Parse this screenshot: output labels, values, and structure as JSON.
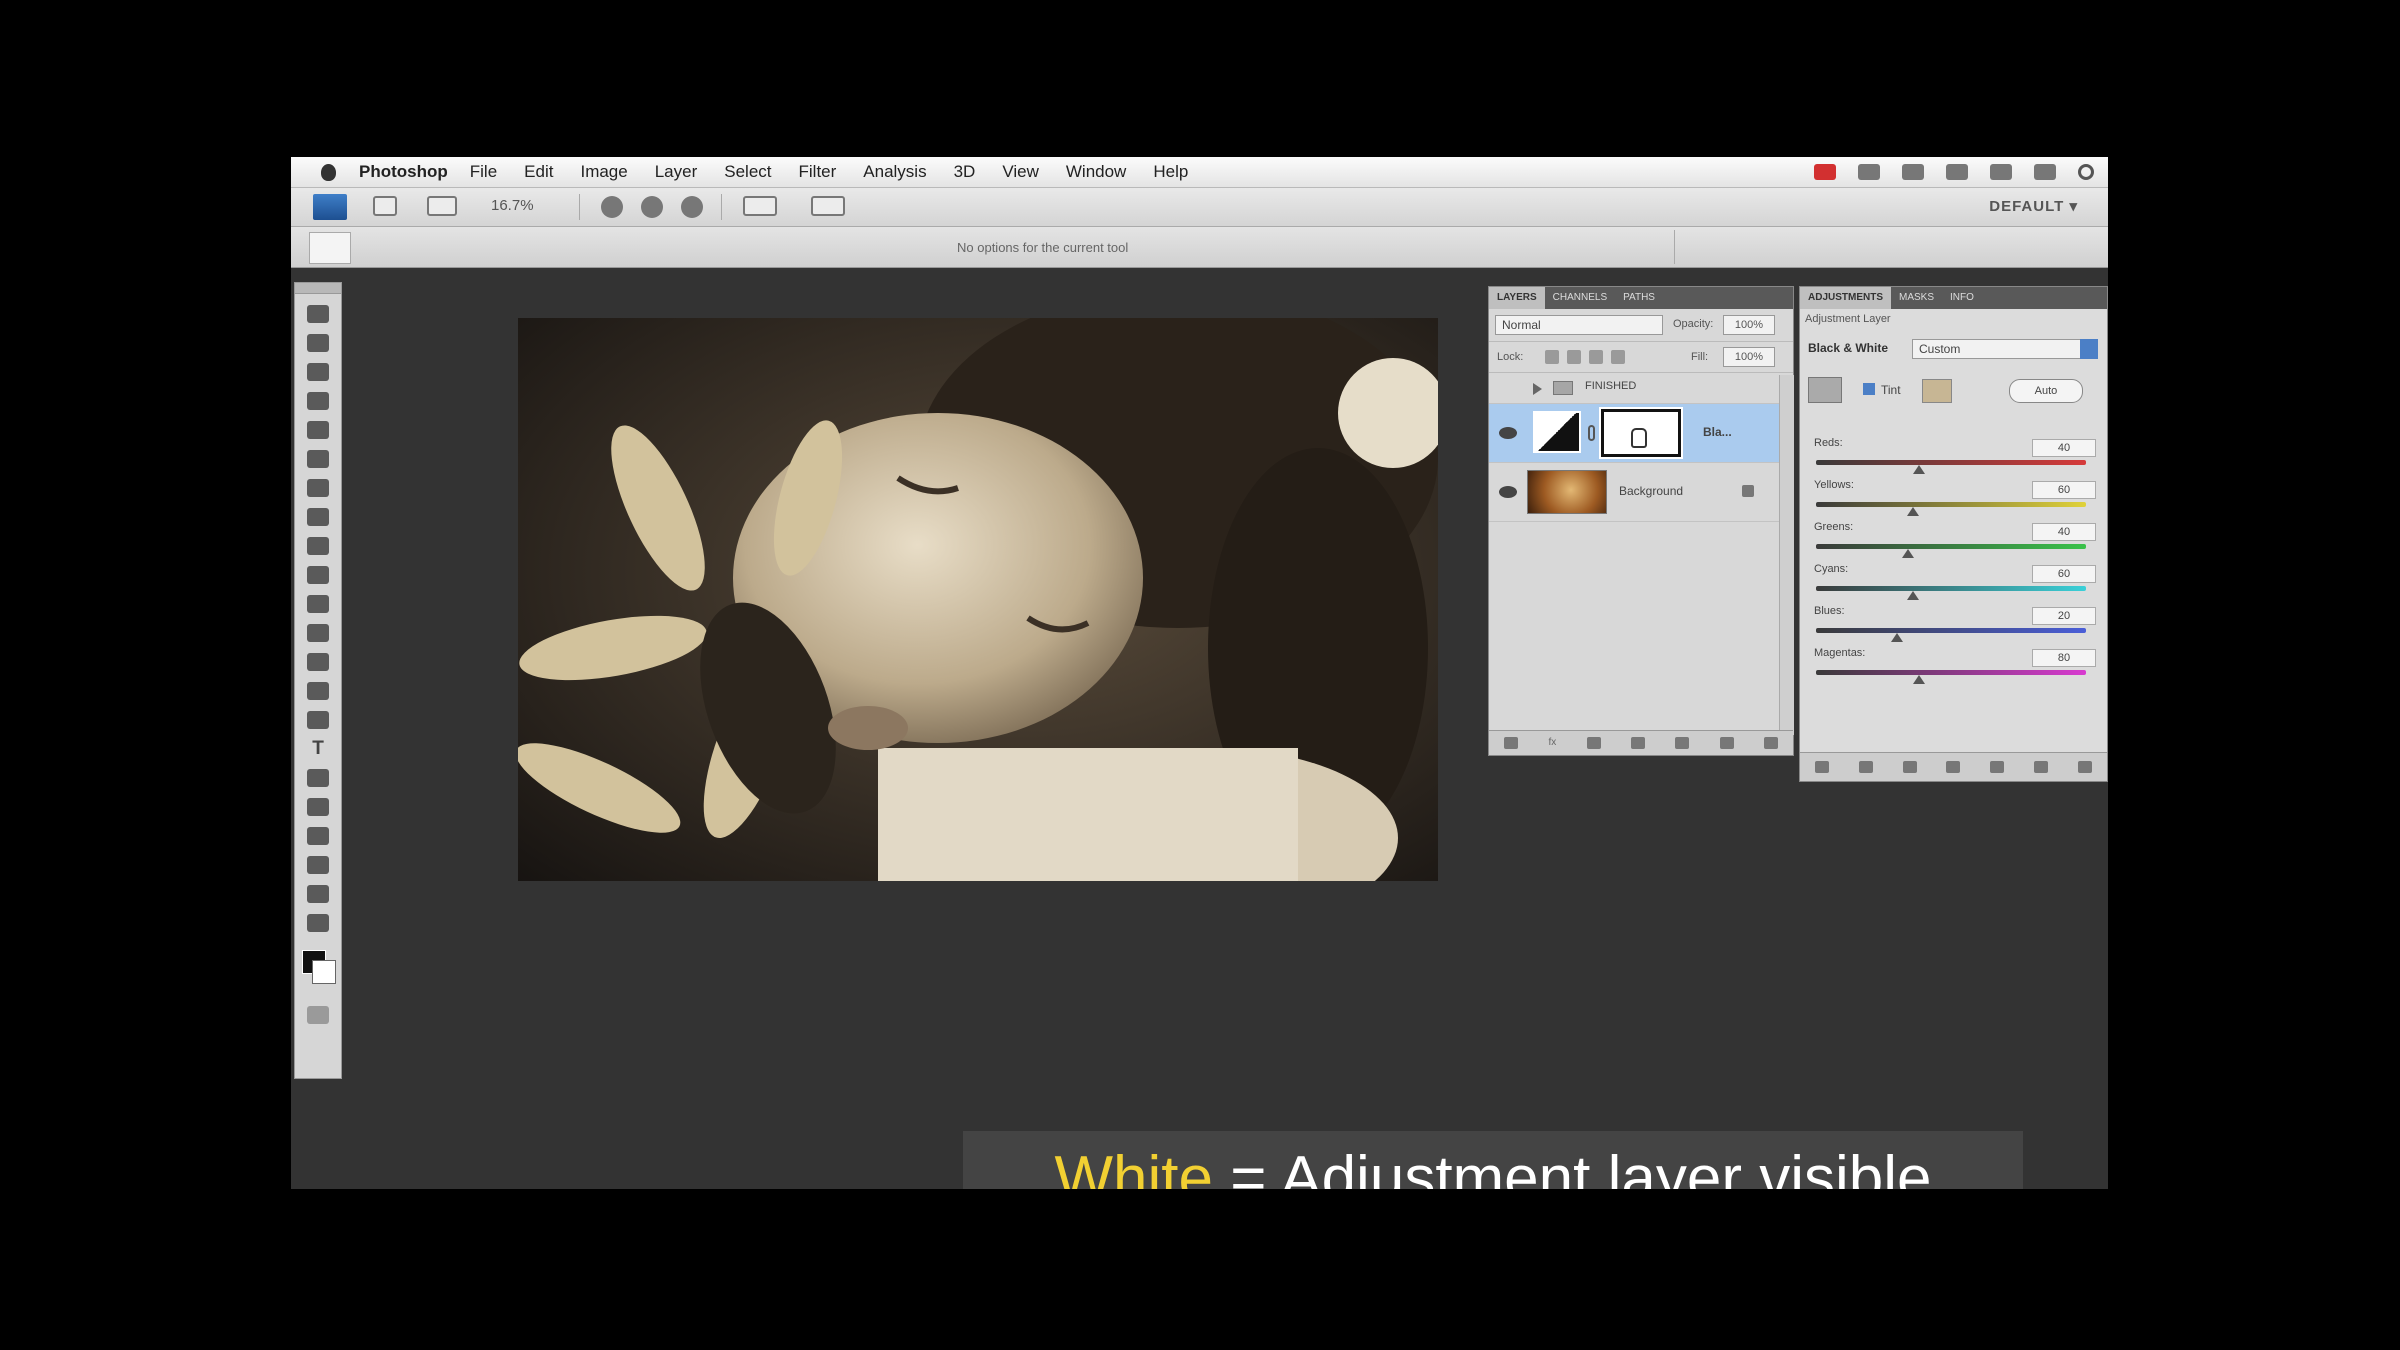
{
  "menubar": {
    "app_name": "Photoshop",
    "items": [
      "File",
      "Edit",
      "Image",
      "Layer",
      "Select",
      "Filter",
      "Analysis",
      "3D",
      "View",
      "Window",
      "Help"
    ]
  },
  "appbar": {
    "zoom": "16.7%",
    "workspace": "DEFAULT ▾"
  },
  "options_bar": {
    "message": "No options for the current tool"
  },
  "layers_panel": {
    "tabs": [
      "LAYERS",
      "CHANNELS",
      "PATHS"
    ],
    "blend_mode": "Normal",
    "opacity_label": "Opacity:",
    "opacity_value": "100%",
    "lock_label": "Lock:",
    "fill_label": "Fill:",
    "fill_value": "100%",
    "layers": [
      {
        "name": "FINISHED",
        "kind": "group"
      },
      {
        "name": "Bla...",
        "kind": "adjustment"
      },
      {
        "name": "Background",
        "kind": "image"
      }
    ],
    "footer_link": "fx"
  },
  "adjustments_panel": {
    "tabs": [
      "ADJUSTMENTS",
      "MASKS",
      "INFO"
    ],
    "subtitle": "Adjustment Layer",
    "type_label": "Black & White",
    "preset": "Custom",
    "tint_label": "Tint",
    "auto_label": "Auto",
    "sliders": [
      {
        "label": "Reds:",
        "value": "40",
        "fraction": 0.38,
        "gradient": "linear-gradient(90deg,#3a3a3a,#d63a3a)"
      },
      {
        "label": "Yellows:",
        "value": "60",
        "fraction": 0.36,
        "gradient": "linear-gradient(90deg,#3a3a3a,#e0d23a)"
      },
      {
        "label": "Greens:",
        "value": "40",
        "fraction": 0.34,
        "gradient": "linear-gradient(90deg,#3a3a3a,#3ac24a)"
      },
      {
        "label": "Cyans:",
        "value": "60",
        "fraction": 0.36,
        "gradient": "linear-gradient(90deg,#3a3a3a,#3ad0d8)"
      },
      {
        "label": "Blues:",
        "value": "20",
        "fraction": 0.3,
        "gradient": "linear-gradient(90deg,#3a3a3a,#4a5ed8)"
      },
      {
        "label": "Magentas:",
        "value": "80",
        "fraction": 0.38,
        "gradient": "linear-gradient(90deg,#3a3a3a,#d83ad0)"
      }
    ]
  },
  "caption": {
    "highlight": "White",
    "rest": " = Adjustment layer visible"
  }
}
